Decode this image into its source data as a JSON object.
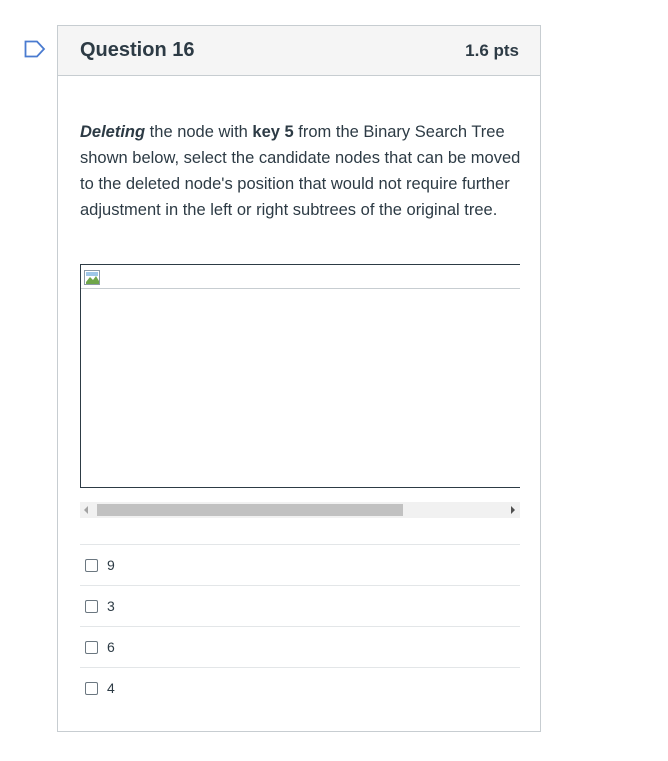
{
  "question": {
    "title": "Question 16",
    "points": "1.6 pts",
    "text": {
      "bold_italic_start": "Deleting",
      "part1": " the node with ",
      "bold_key": "key 5",
      "part2": " from the Binary Search Tree shown below, select the candidate nodes that can be moved to the deleted node's position that would not require further adjustment  in the left or right subtrees of the original tree."
    }
  },
  "answers": [
    {
      "label": "9"
    },
    {
      "label": "3"
    },
    {
      "label": "6"
    },
    {
      "label": "4"
    }
  ],
  "colors": {
    "flag": "#4a7bd0",
    "header_bg": "#f5f5f5",
    "border": "#c7cdd1",
    "text": "#2d3b45"
  },
  "icons": {
    "flag": "bookmark-flag-icon",
    "broken_image": "broken-image-icon"
  }
}
